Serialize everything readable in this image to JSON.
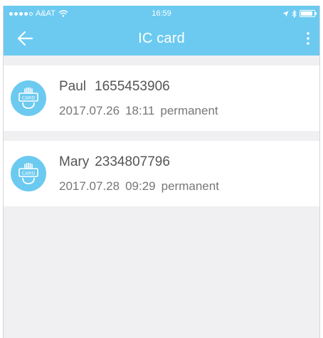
{
  "status_bar": {
    "carrier": "A&AT",
    "time": "16:59"
  },
  "header": {
    "title": "IC card",
    "back_icon": "arrow-left-icon",
    "menu_icon": "more-vertical-icon"
  },
  "cards": [
    {
      "name": "Paul",
      "card_number": "1655453906",
      "date": "2017.07.26",
      "time": "18:11",
      "validity": "permanent"
    },
    {
      "name": "Mary",
      "card_number": "2334807796",
      "date": "2017.07.28",
      "time": "09:29",
      "validity": "permanent"
    }
  ],
  "colors": {
    "primary": "#6ccaf0",
    "background": "#f0f0f2",
    "item_background": "#ffffff",
    "text": "#606060"
  }
}
